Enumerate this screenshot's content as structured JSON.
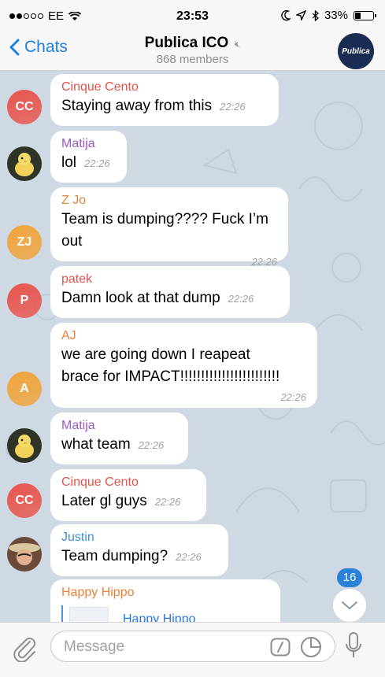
{
  "status_bar": {
    "carrier": "EE",
    "time": "23:53",
    "battery": "33%",
    "battery_level": 0.33
  },
  "header": {
    "back_label": "Chats",
    "title": "Publica ICO",
    "subtitle": "868 members",
    "avatar_label": "Publica"
  },
  "messages": [
    {
      "sender": "Cinque Cento",
      "initials": "CC",
      "name_color": "#e5534b",
      "avatar_color": "#e8554e",
      "text": "Staying away from this",
      "time": "22:26"
    },
    {
      "sender": "Matija",
      "initials": "",
      "name_color": "#9b59c6",
      "avatar_color": "#2a2f25",
      "text": "lol",
      "time": "22:26"
    },
    {
      "sender": "Z Jo",
      "initials": "ZJ",
      "name_color": "#e8833a",
      "avatar_color": "#f0a43b",
      "text": "Team is dumping???? Fuck I’m\nout",
      "time": "22:26"
    },
    {
      "sender": "patek",
      "initials": "P",
      "name_color": "#e5534b",
      "avatar_color": "#e8554e",
      "text": "Damn look at that dump",
      "time": "22:26"
    },
    {
      "sender": "AJ",
      "initials": "A",
      "name_color": "#e8833a",
      "avatar_color": "#f0a43b",
      "text": "we are going down I reapeat\nbrace for IMPACT!!!!!!!!!!!!!!!!!!!!!!!!",
      "time": "22:26"
    },
    {
      "sender": "Matija",
      "initials": "",
      "name_color": "#9b59c6",
      "avatar_color": "#2a2f25",
      "text": "what team",
      "time": "22:26"
    },
    {
      "sender": "Cinque Cento",
      "initials": "CC",
      "name_color": "#e5534b",
      "avatar_color": "#e8554e",
      "text": "Later gl guys",
      "time": "22:26"
    },
    {
      "sender": "Justin",
      "initials": "",
      "name_color": "#3d8fd6",
      "avatar_color": "#5a3b30",
      "text": "Team dumping?",
      "time": "22:26"
    },
    {
      "sender": "Happy Hippo",
      "initials": "",
      "name_color": "#e8833a",
      "avatar_color": "#ffffff",
      "reply_to": "Happy Hippo"
    }
  ],
  "scroll_button": {
    "unread_count": "16"
  },
  "input": {
    "placeholder": "Message"
  },
  "colors": {
    "accent": "#1f7fdc",
    "chat_background": "#cfd9e4"
  }
}
